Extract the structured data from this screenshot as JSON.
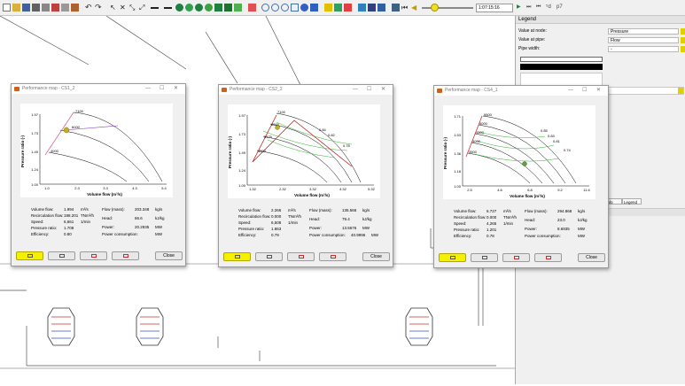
{
  "toolbar": {
    "time": "1:07:15:16",
    "speed_label": "p7",
    "nav_glyphs": [
      "▶",
      "⏭",
      "⏮",
      "⁵d"
    ]
  },
  "legend_panel": {
    "title": "Legend",
    "rows": [
      {
        "label": "Value at node:",
        "value": "Pressure"
      },
      {
        "label": "Value at pipe:",
        "value": "Flow"
      },
      {
        "label": "Pipe width:",
        "value": "-"
      }
    ],
    "tabs": [
      "Info",
      "Legend"
    ]
  },
  "windows": [
    {
      "title": "Performance map - CS1_2",
      "controls": [
        "—",
        "☐",
        "✕"
      ],
      "stats_left": [
        {
          "label": "Volume flow:",
          "value": "1.994",
          "unit": "m³/s"
        },
        {
          "label": "Recirculation flow:",
          "value": "198.201",
          "unit": "TNm³/h"
        },
        {
          "label": "Speed:",
          "value": "6,661",
          "unit": "1/min"
        },
        {
          "label": "Pressure ratio:",
          "value": "1.708",
          "unit": ""
        },
        {
          "label": "Efficiency:",
          "value": "0.80",
          "unit": ""
        }
      ],
      "stats_right": [
        {
          "label": "Flow (mass):",
          "value": "203.348",
          "unit": "kg/s"
        },
        {
          "label": "Head:",
          "value": "66.6",
          "unit": "kJ/kg"
        },
        {
          "label": "Power:",
          "value": "20.2935",
          "unit": "MW"
        },
        {
          "label": "Power consumption:",
          "value": "",
          "unit": "MW"
        }
      ],
      "close_label": "Close",
      "plot": {
        "xlabel": "Volume flow (m³/s)",
        "ylabel": "Pressure ratio (-)",
        "xticks": [
          "1.0",
          "2.3",
          "3.3",
          "4.3",
          "5.4"
        ],
        "yticks": [
          "1.97",
          "1.73",
          "1.49",
          "1.24",
          "1.00"
        ],
        "speed_labels": [
          "7100",
          "6000",
          "4000"
        ]
      }
    },
    {
      "title": "Performance map - CS2_2",
      "controls": [
        "—",
        "☐",
        "✕"
      ],
      "stats_left": [
        {
          "label": "Volume flow:",
          "value": "2.266",
          "unit": "m³/s"
        },
        {
          "label": "Recirculation flow:",
          "value": "0.000",
          "unit": "TNm³/h"
        },
        {
          "label": "Speed:",
          "value": "6,508",
          "unit": "1/min"
        },
        {
          "label": "Pressure ratio:",
          "value": "1.863",
          "unit": ""
        },
        {
          "label": "Efficiency:",
          "value": "0.79",
          "unit": ""
        }
      ],
      "stats_right": [
        {
          "label": "Flow (mass):",
          "value": "135.566",
          "unit": "kg/s"
        },
        {
          "label": "Head:",
          "value": "79.4",
          "unit": "kJ/kg"
        },
        {
          "label": "Power:",
          "value": "13.5676",
          "unit": "MW"
        },
        {
          "label": "Power consumption:",
          "value": "40.9996",
          "unit": "MW"
        }
      ],
      "close_label": "Close",
      "plot": {
        "xlabel": "Volume flow (m³/s)",
        "ylabel": "Pressure ratio (-)",
        "xticks": [
          "1.32",
          "2.32",
          "3.32",
          "4.32",
          "5.32"
        ],
        "yticks": [
          "1.97",
          "1.73",
          "1.49",
          "1.24",
          "1.00"
        ],
        "speed_labels": [
          "7100",
          "6000",
          "5175",
          "4200"
        ],
        "eff_labels": [
          "0.84",
          "0.82",
          "0.78"
        ]
      }
    },
    {
      "title": "Performance map - CS4_1",
      "controls": [
        "—",
        "☐",
        "✕"
      ],
      "stats_left": [
        {
          "label": "Volume flow:",
          "value": "6.727",
          "unit": "m³/s"
        },
        {
          "label": "Recirculation flow:",
          "value": "0.000",
          "unit": "TNm³/h"
        },
        {
          "label": "Speed:",
          "value": "4,265",
          "unit": "1/min"
        },
        {
          "label": "Pressure ratio:",
          "value": "1.201",
          "unit": ""
        },
        {
          "label": "Efficiency:",
          "value": "0.78",
          "unit": ""
        }
      ],
      "stats_right": [
        {
          "label": "Flow (mass):",
          "value": "294.868",
          "unit": "kg/s"
        },
        {
          "label": "Head:",
          "value": "23.0",
          "unit": "kJ/kg"
        },
        {
          "label": "Power:",
          "value": "8.6935",
          "unit": "MW"
        },
        {
          "label": "Power consumption:",
          "value": "",
          "unit": "MW"
        }
      ],
      "close_label": "Close",
      "plot": {
        "xlabel": "Volume flow (m³/s)",
        "ylabel": "Pressure ratio (-)",
        "xticks": [
          "2.5",
          "4.6",
          "6.8",
          "9.2",
          "11.6"
        ],
        "yticks": [
          "1.71",
          "1.53",
          "1.36",
          "1.18",
          "1.00"
        ],
        "speed_labels": [
          "5500",
          "5000",
          "4500",
          "4000",
          "3500"
        ],
        "eff_labels": [
          "0.85",
          "0.83",
          "0.81",
          "0.74"
        ]
      }
    }
  ]
}
